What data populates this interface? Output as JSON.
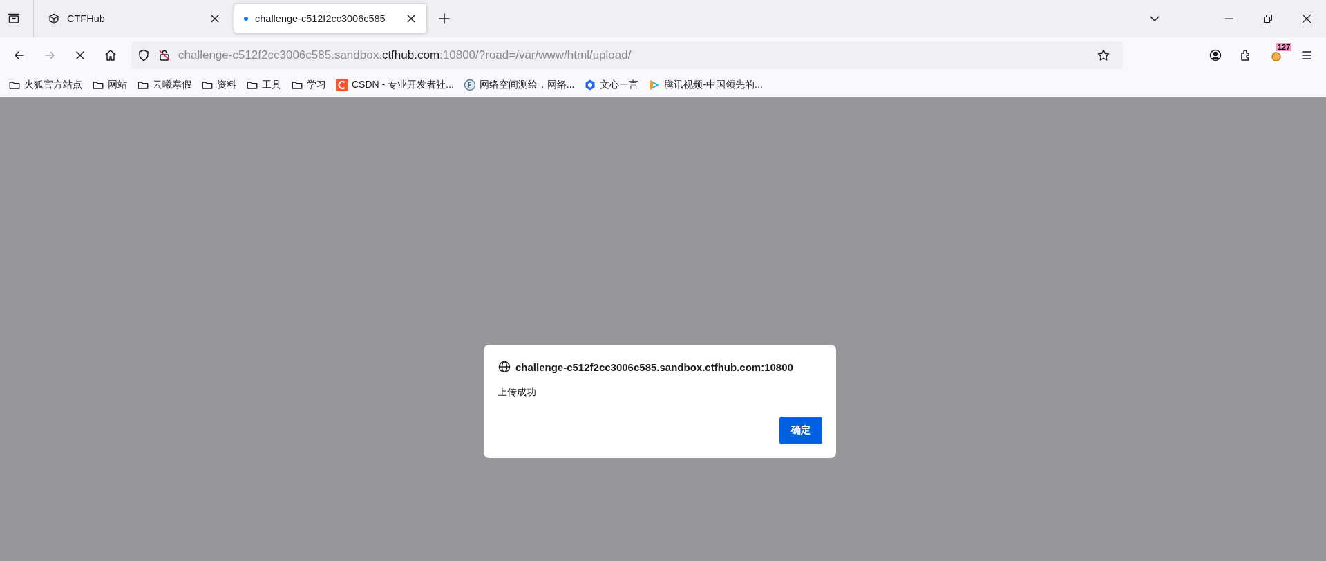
{
  "tabs": [
    {
      "title": "CTFHub",
      "selected": false,
      "loading": false
    },
    {
      "title": "challenge-c512f2cc3006c585",
      "selected": true,
      "loading": true
    }
  ],
  "address_bar": {
    "prefix": "challenge-c512f2cc3006c585.sandbox.",
    "domain": "ctfhub.com",
    "suffix": ":10800/?road=/var/www/html/upload/"
  },
  "extension_badge": "127",
  "bookmarks": [
    {
      "kind": "folder",
      "label": "火狐官方站点"
    },
    {
      "kind": "folder",
      "label": "网站"
    },
    {
      "kind": "folder",
      "label": "云曦寒假"
    },
    {
      "kind": "folder",
      "label": "资料"
    },
    {
      "kind": "folder",
      "label": "工具"
    },
    {
      "kind": "folder",
      "label": "学习"
    },
    {
      "kind": "csdn",
      "label": "CSDN - 专业开发者社..."
    },
    {
      "kind": "map",
      "label": "网络空间测绘，网络..."
    },
    {
      "kind": "cube",
      "label": "文心一言"
    },
    {
      "kind": "play",
      "label": "腾讯视频-中国领先的..."
    }
  ],
  "dialog": {
    "origin": "challenge-c512f2cc3006c585.sandbox.ctfhub.com:10800",
    "message": "上传成功",
    "button": "确定"
  }
}
